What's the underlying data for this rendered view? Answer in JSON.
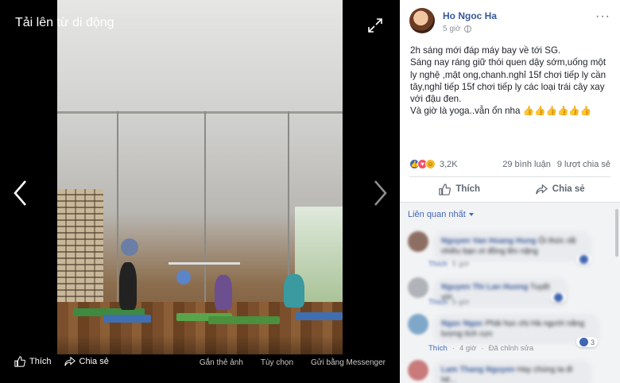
{
  "viewer": {
    "title": "Tải lên từ di động",
    "actions": {
      "like": "Thích",
      "share": "Chia sẻ",
      "tag": "Gắn thẻ ảnh",
      "options": "Tùy chọn",
      "send": "Gửi bằng Messenger"
    }
  },
  "post": {
    "author": "Ho Ngoc Ha",
    "time": "5 giờ",
    "privacy_icon": "globe-icon",
    "text": [
      "2h sáng mới đáp máy bay về tới SG.",
      "Sáng nay ráng giữ thói quen dậy sớm,uống một ly nghệ ,mật ong,chanh.nghỉ 15f chơi tiếp ly cần tây,nghỉ tiếp 15f chơi tiếp ly các loại trái cây xay với đậu đen.",
      "Và giờ là yoga..vẫn ổn nha 👍👍👍👍👍👍"
    ],
    "reaction_count": "3,2K",
    "comments_count": "29 bình luận",
    "shares_count": "9 lượt chia sẻ",
    "like_label": "Thích",
    "share_label": "Chia sẻ"
  },
  "comments": {
    "sort_label": "Liên quan nhất",
    "items": [
      {
        "name": "Nguyen Van Hoang Hung",
        "text": "Ôi thức rất nhiều bạn ơi đồng lên nặng",
        "like_label": "Thích",
        "time": "5 giờ",
        "reactions": ""
      },
      {
        "name": "Nguyen Thi Lan Huong",
        "text": "Tuyệt vời",
        "like_label": "Thích",
        "time": "5 giờ",
        "reactions": ""
      },
      {
        "name": "Ngọc Ngọc",
        "text": "Phải học chị Hà người năng lượng tích cực",
        "like_label": "Thích",
        "time": "4 giờ",
        "edited": "Đã chỉnh sửa",
        "reactions": "3"
      },
      {
        "name": "Lam Thang Nguyen",
        "text": "Hay chúng ta đi hê...",
        "like_label": "",
        "time": "",
        "reactions": ""
      }
    ]
  },
  "colors": {
    "link": "#365899",
    "accent": "#4267b2",
    "love": "#f25268",
    "haha": "#f7b928"
  }
}
